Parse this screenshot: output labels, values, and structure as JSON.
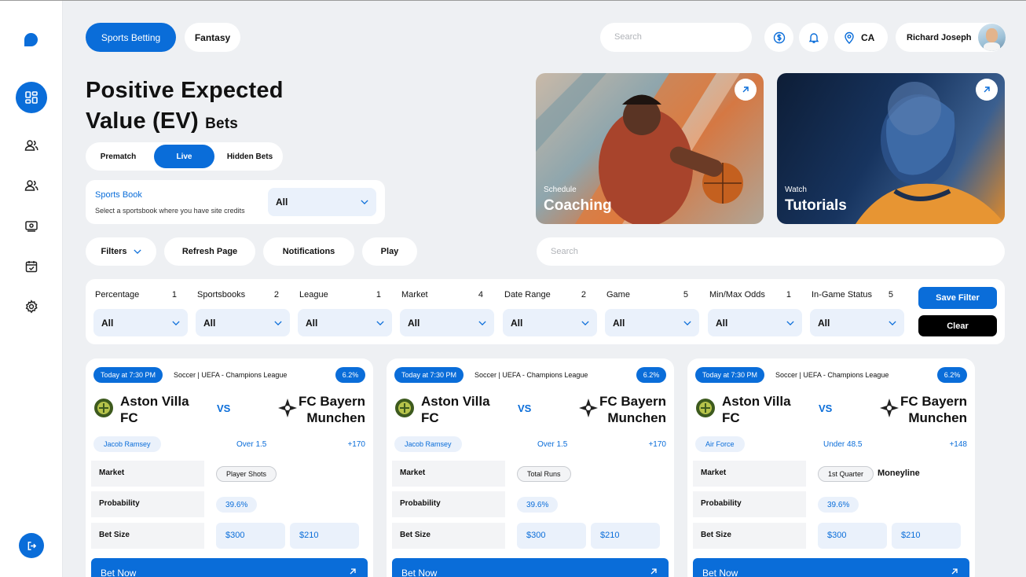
{
  "nav": {
    "tabs": [
      {
        "label": "Sports Betting"
      },
      {
        "label": "Fantasy"
      }
    ],
    "search_placeholder": "Search",
    "location": "CA",
    "user_name": "Richard Joseph"
  },
  "page": {
    "title_line1": "Positive Expected",
    "title_line2": "Value (EV)",
    "title_suffix": "Bets"
  },
  "segments": [
    "Prematch",
    "Live",
    "Hidden Bets"
  ],
  "sportsbook": {
    "label": "Sports Book",
    "description": "Select a sportsbook where you have site credits",
    "selected": "All"
  },
  "actions": {
    "filters": "Filters",
    "refresh": "Refresh Page",
    "notifications": "Notifications",
    "play": "Play"
  },
  "main_search_placeholder": "Search",
  "promos": [
    {
      "tag": "Schedule",
      "title": "Coaching"
    },
    {
      "tag": "Watch",
      "title": "Tutorials"
    }
  ],
  "filters": [
    {
      "name": "Percentage",
      "count": "1",
      "value": "All"
    },
    {
      "name": "Sportsbooks",
      "count": "2",
      "value": "All"
    },
    {
      "name": "League",
      "count": "1",
      "value": "All"
    },
    {
      "name": "Market",
      "count": "4",
      "value": "All"
    },
    {
      "name": "Date Range",
      "count": "2",
      "value": "All"
    },
    {
      "name": "Game",
      "count": "5",
      "value": "All"
    },
    {
      "name": "Min/Max Odds",
      "count": "1",
      "value": "All"
    },
    {
      "name": "In-Game Status",
      "count": "5",
      "value": "All"
    }
  ],
  "filter_buttons": {
    "save": "Save Filter",
    "clear": "Clear"
  },
  "row_labels": {
    "market": "Market",
    "probability": "Probability",
    "bet_size": "Bet Size"
  },
  "cards": [
    {
      "time": "Today at 7:30 PM",
      "league": "Soccer | UEFA - Champions League",
      "percent": "6.2%",
      "home_line1": "Aston Villa",
      "home_line2": "FC",
      "vs": "VS",
      "away_line1": "FC Bayern",
      "away_line2": "Munchen",
      "player": "Jacob Ramsey",
      "line": "Over 1.5",
      "odds": "+170",
      "market": "Player Shots",
      "market_extra": "",
      "probability": "39.6%",
      "bet1": "$300",
      "bet2": "$210",
      "cta": "Bet Now"
    },
    {
      "time": "Today at 7:30 PM",
      "league": "Soccer | UEFA - Champions League",
      "percent": "6.2%",
      "home_line1": "Aston Villa",
      "home_line2": "FC",
      "vs": "VS",
      "away_line1": "FC Bayern",
      "away_line2": "Munchen",
      "player": "Jacob Ramsey",
      "line": "Over 1.5",
      "odds": "+170",
      "market": "Total Runs",
      "market_extra": "",
      "probability": "39.6%",
      "bet1": "$300",
      "bet2": "$210",
      "cta": "Bet Now"
    },
    {
      "time": "Today at 7:30 PM",
      "league": "Soccer | UEFA - Champions League",
      "percent": "6.2%",
      "home_line1": "Aston Villa",
      "home_line2": "FC",
      "vs": "VS",
      "away_line1": "FC Bayern",
      "away_line2": "Munchen",
      "player": "Air Force",
      "line": "Under 48.5",
      "odds": "+148",
      "market": "1st Quarter",
      "market_extra": "Moneyline",
      "probability": "39.6%",
      "bet1": "$300",
      "bet2": "$210",
      "cta": "Bet Now"
    }
  ],
  "colors": {
    "accent": "#0a6dd9",
    "background": "#eef0f3",
    "soft_blue": "#eaf1fb"
  }
}
